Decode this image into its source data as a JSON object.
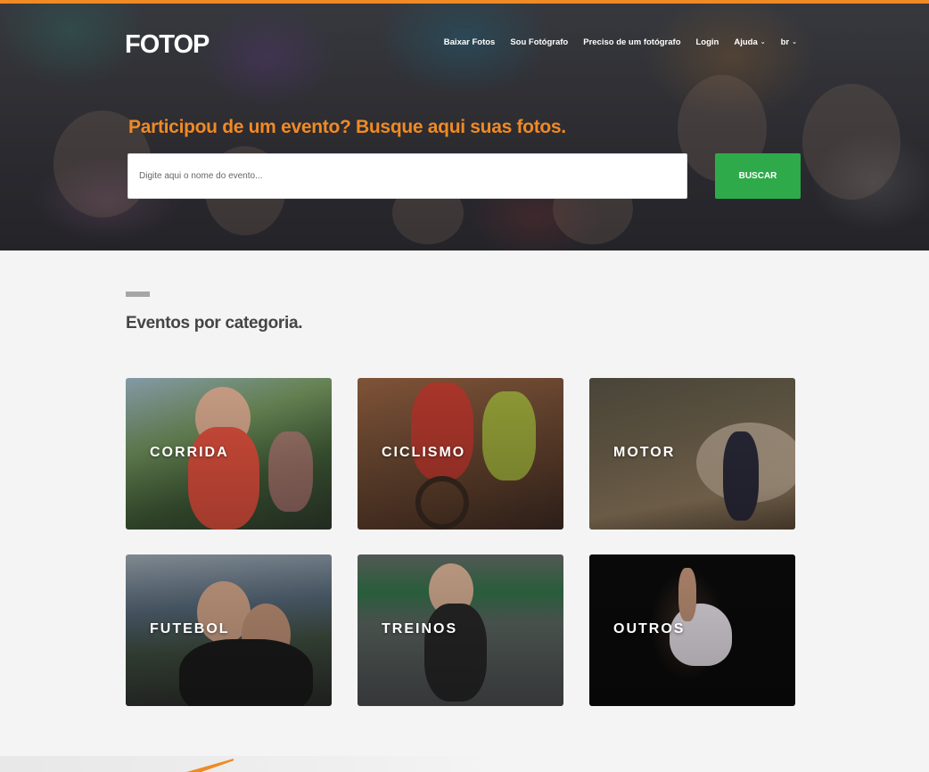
{
  "brand": {
    "name": "FOTOP",
    "accent": "#f08a24",
    "green": "#2eaa4a"
  },
  "nav": {
    "items": [
      {
        "label": "Baixar Fotos"
      },
      {
        "label": "Sou Fotógrafo"
      },
      {
        "label": "Preciso de um fotógrafo"
      },
      {
        "label": "Login"
      },
      {
        "label": "Ajuda",
        "dropdown": true
      },
      {
        "label": "br",
        "dropdown": true
      }
    ]
  },
  "hero": {
    "title": "Participou de um evento? Busque aqui suas fotos.",
    "search_placeholder": "Digite aqui o nome do evento...",
    "search_button": "BUSCAR"
  },
  "section": {
    "title": "Eventos por categoria."
  },
  "categories": [
    {
      "label": "CORRIDA"
    },
    {
      "label": "CICLISMO"
    },
    {
      "label": "MOTOR"
    },
    {
      "label": "FUTEBOL"
    },
    {
      "label": "TREINOS"
    },
    {
      "label": "OUTROS"
    }
  ]
}
